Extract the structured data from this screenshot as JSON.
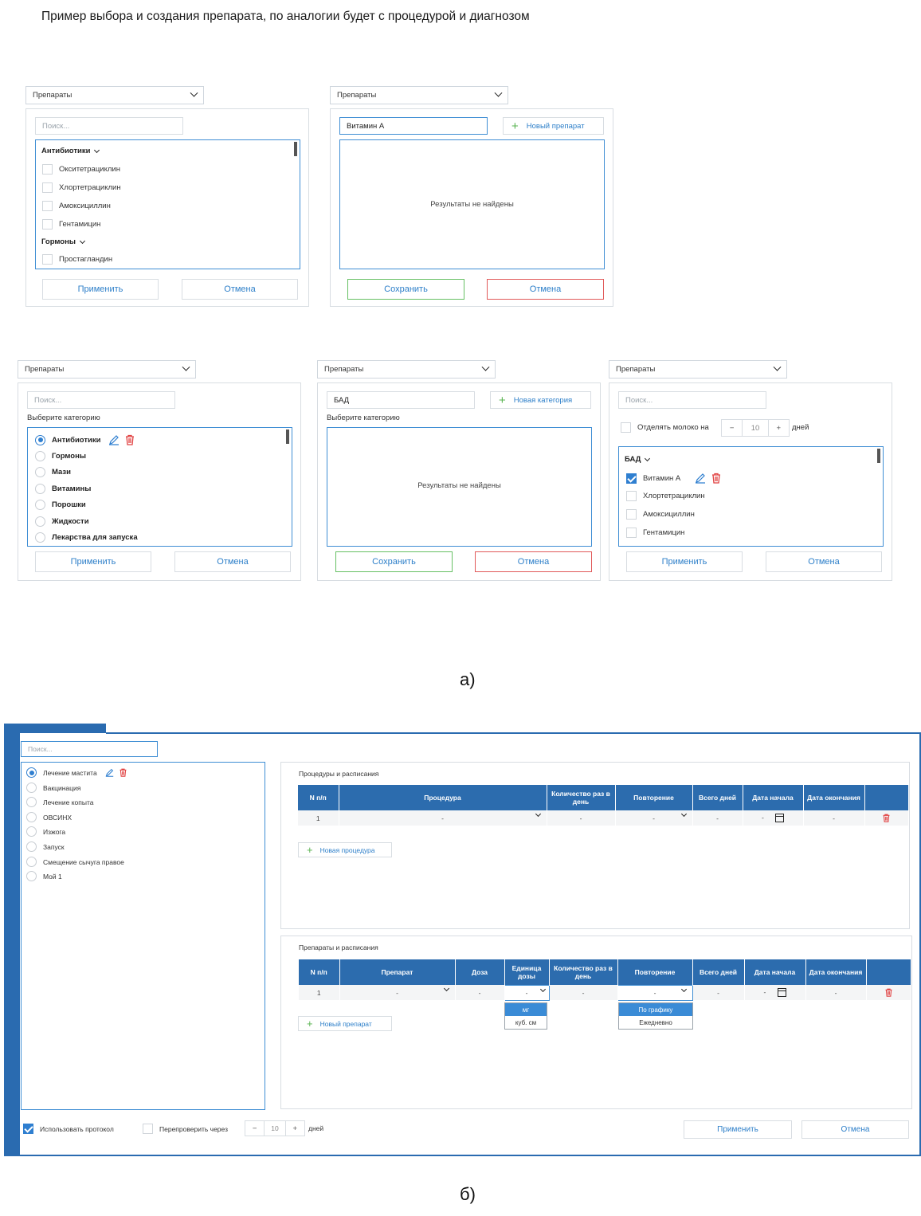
{
  "title": "Пример выбора и создания препарата, по аналогии будет с процедурой и диагнозом",
  "common": {
    "select": "Препараты",
    "search": "Поиск...",
    "apply": "Применить",
    "cancel": "Отмена",
    "save": "Сохранить",
    "no_results": "Результаты не найдены",
    "choose_category": "Выберите категорию",
    "days": "дней"
  },
  "p1": {
    "group1": "Антибиотики",
    "items1": [
      "Окситетрациклин",
      "Хлортетрациклин",
      "Амоксициллин",
      "Гентамицин"
    ],
    "group2": "Гормоны",
    "items2": [
      "Простагландин"
    ]
  },
  "p2": {
    "input": "Витамин А",
    "new_btn": "Новый препарат"
  },
  "p3": {
    "categories": [
      "Антибиотики",
      "Гормоны",
      "Мази",
      "Витамины",
      "Порошки",
      "Жидкости",
      "Лекарства для запуска"
    ]
  },
  "p4": {
    "input": "БАД",
    "new_btn": "Новая категория"
  },
  "p5": {
    "milk_label": "Отделять молоко на",
    "milk_value": "10",
    "group": "БАД",
    "items": [
      "Витамин А",
      "Хлортетрациклин",
      "Амоксициллин",
      "Гентамицин"
    ]
  },
  "caption_a": "а)",
  "caption_b": "б)",
  "b": {
    "search": "Поиск...",
    "diagnoses": [
      "Лечение мастита",
      "Вакцинация",
      "Лечение копыта",
      "ОВСИНХ",
      "Изжога",
      "Запуск",
      "Смещение сычуга правое",
      "Мой 1"
    ],
    "proc_title": "Процедуры и расписания",
    "proc_headers": [
      "N п/п",
      "Процедура",
      "Количество раз в день",
      "Повторение",
      "Всего дней",
      "Дата начала",
      "Дата окончания",
      ""
    ],
    "proc_row": {
      "n": "1",
      "dash": "-"
    },
    "new_proc": "Новая процедура",
    "drug_title": "Препараты и расписания",
    "drug_headers": [
      "N п/п",
      "Препарат",
      "Доза",
      "Единица дозы",
      "Количество раз в день",
      "Повторение",
      "Всего дней",
      "Дата начала",
      "Дата окончания",
      ""
    ],
    "new_drug": "Новый препарат",
    "unit_options": [
      "мг",
      "куб. см"
    ],
    "repeat_options": [
      "По графику",
      "Ежедневно"
    ],
    "use_protocol": "Использовать протокол",
    "recheck": "Перепроверить через",
    "recheck_value": "10"
  },
  "colors": {
    "accent": "#2c6cae",
    "focus": "#3f8ed4",
    "green": "#66c063",
    "red": "#e15a5a"
  }
}
